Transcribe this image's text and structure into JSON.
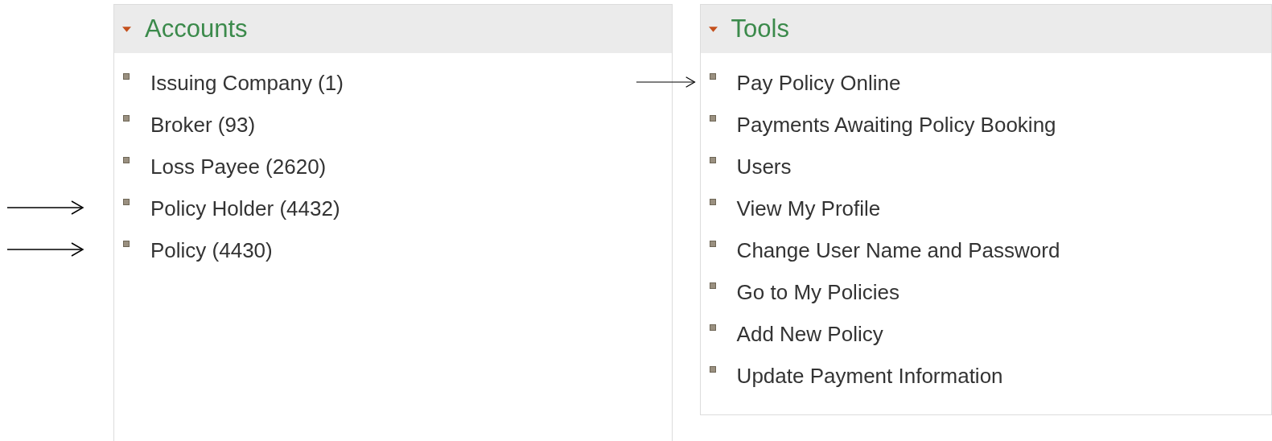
{
  "panels": [
    {
      "title": "Accounts",
      "expanded": true,
      "items": [
        {
          "label": "Issuing Company (1)",
          "arrow": false
        },
        {
          "label": "Broker (93)",
          "arrow": false
        },
        {
          "label": "Loss Payee (2620)",
          "arrow": false
        },
        {
          "label": "Policy Holder (4432)",
          "arrow": true
        },
        {
          "label": "Policy (4430)",
          "arrow": true
        }
      ]
    },
    {
      "title": "Tools",
      "expanded": true,
      "items": [
        {
          "label": "Pay Policy Online",
          "arrow": true
        },
        {
          "label": "Payments Awaiting Policy Booking",
          "arrow": false
        },
        {
          "label": "Users",
          "arrow": false
        },
        {
          "label": "View My Profile",
          "arrow": false
        },
        {
          "label": "Change User Name and Password",
          "arrow": false
        },
        {
          "label": "Go to My Policies",
          "arrow": false
        },
        {
          "label": "Add New Policy",
          "arrow": false
        },
        {
          "label": "Update Payment Information",
          "arrow": false
        }
      ]
    }
  ]
}
